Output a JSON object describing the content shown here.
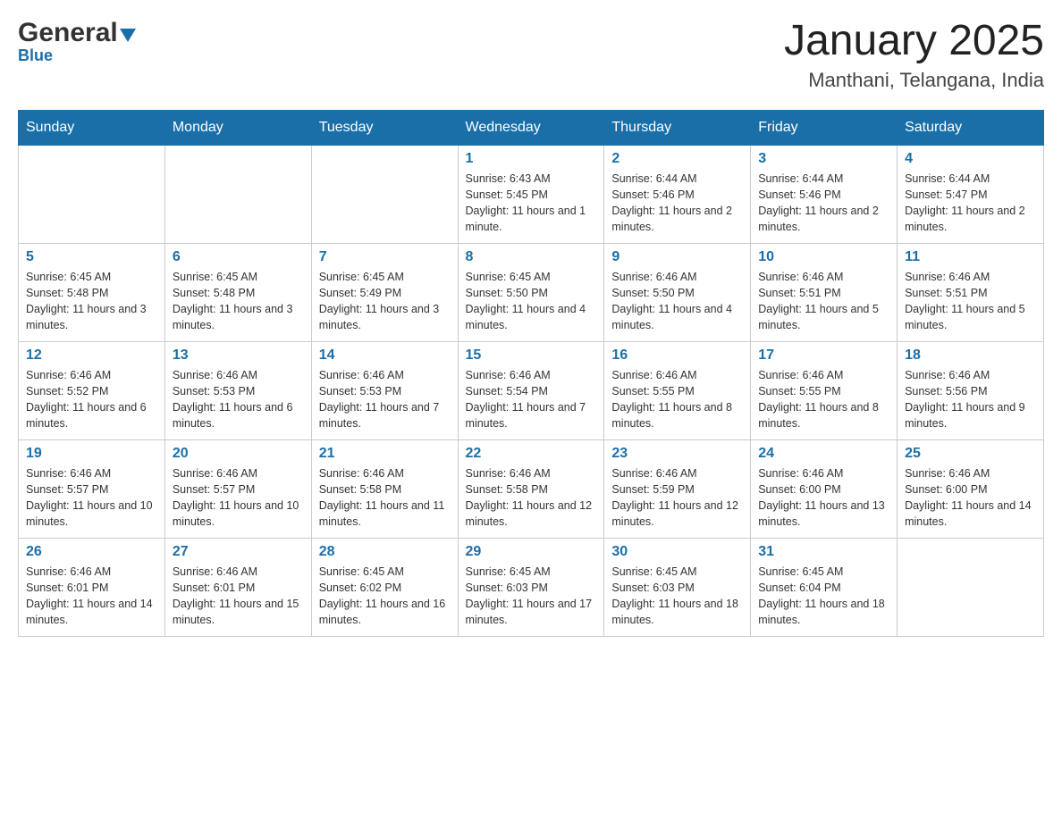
{
  "header": {
    "logo_general": "General",
    "logo_blue": "Blue",
    "title": "January 2025",
    "subtitle": "Manthani, Telangana, India"
  },
  "days_header": [
    "Sunday",
    "Monday",
    "Tuesday",
    "Wednesday",
    "Thursday",
    "Friday",
    "Saturday"
  ],
  "weeks": [
    {
      "cells": [
        {
          "day": null,
          "info": null
        },
        {
          "day": null,
          "info": null
        },
        {
          "day": null,
          "info": null
        },
        {
          "day": "1",
          "info": "Sunrise: 6:43 AM\nSunset: 5:45 PM\nDaylight: 11 hours and 1 minute."
        },
        {
          "day": "2",
          "info": "Sunrise: 6:44 AM\nSunset: 5:46 PM\nDaylight: 11 hours and 2 minutes."
        },
        {
          "day": "3",
          "info": "Sunrise: 6:44 AM\nSunset: 5:46 PM\nDaylight: 11 hours and 2 minutes."
        },
        {
          "day": "4",
          "info": "Sunrise: 6:44 AM\nSunset: 5:47 PM\nDaylight: 11 hours and 2 minutes."
        }
      ]
    },
    {
      "cells": [
        {
          "day": "5",
          "info": "Sunrise: 6:45 AM\nSunset: 5:48 PM\nDaylight: 11 hours and 3 minutes."
        },
        {
          "day": "6",
          "info": "Sunrise: 6:45 AM\nSunset: 5:48 PM\nDaylight: 11 hours and 3 minutes."
        },
        {
          "day": "7",
          "info": "Sunrise: 6:45 AM\nSunset: 5:49 PM\nDaylight: 11 hours and 3 minutes."
        },
        {
          "day": "8",
          "info": "Sunrise: 6:45 AM\nSunset: 5:50 PM\nDaylight: 11 hours and 4 minutes."
        },
        {
          "day": "9",
          "info": "Sunrise: 6:46 AM\nSunset: 5:50 PM\nDaylight: 11 hours and 4 minutes."
        },
        {
          "day": "10",
          "info": "Sunrise: 6:46 AM\nSunset: 5:51 PM\nDaylight: 11 hours and 5 minutes."
        },
        {
          "day": "11",
          "info": "Sunrise: 6:46 AM\nSunset: 5:51 PM\nDaylight: 11 hours and 5 minutes."
        }
      ]
    },
    {
      "cells": [
        {
          "day": "12",
          "info": "Sunrise: 6:46 AM\nSunset: 5:52 PM\nDaylight: 11 hours and 6 minutes."
        },
        {
          "day": "13",
          "info": "Sunrise: 6:46 AM\nSunset: 5:53 PM\nDaylight: 11 hours and 6 minutes."
        },
        {
          "day": "14",
          "info": "Sunrise: 6:46 AM\nSunset: 5:53 PM\nDaylight: 11 hours and 7 minutes."
        },
        {
          "day": "15",
          "info": "Sunrise: 6:46 AM\nSunset: 5:54 PM\nDaylight: 11 hours and 7 minutes."
        },
        {
          "day": "16",
          "info": "Sunrise: 6:46 AM\nSunset: 5:55 PM\nDaylight: 11 hours and 8 minutes."
        },
        {
          "day": "17",
          "info": "Sunrise: 6:46 AM\nSunset: 5:55 PM\nDaylight: 11 hours and 8 minutes."
        },
        {
          "day": "18",
          "info": "Sunrise: 6:46 AM\nSunset: 5:56 PM\nDaylight: 11 hours and 9 minutes."
        }
      ]
    },
    {
      "cells": [
        {
          "day": "19",
          "info": "Sunrise: 6:46 AM\nSunset: 5:57 PM\nDaylight: 11 hours and 10 minutes."
        },
        {
          "day": "20",
          "info": "Sunrise: 6:46 AM\nSunset: 5:57 PM\nDaylight: 11 hours and 10 minutes."
        },
        {
          "day": "21",
          "info": "Sunrise: 6:46 AM\nSunset: 5:58 PM\nDaylight: 11 hours and 11 minutes."
        },
        {
          "day": "22",
          "info": "Sunrise: 6:46 AM\nSunset: 5:58 PM\nDaylight: 11 hours and 12 minutes."
        },
        {
          "day": "23",
          "info": "Sunrise: 6:46 AM\nSunset: 5:59 PM\nDaylight: 11 hours and 12 minutes."
        },
        {
          "day": "24",
          "info": "Sunrise: 6:46 AM\nSunset: 6:00 PM\nDaylight: 11 hours and 13 minutes."
        },
        {
          "day": "25",
          "info": "Sunrise: 6:46 AM\nSunset: 6:00 PM\nDaylight: 11 hours and 14 minutes."
        }
      ]
    },
    {
      "cells": [
        {
          "day": "26",
          "info": "Sunrise: 6:46 AM\nSunset: 6:01 PM\nDaylight: 11 hours and 14 minutes."
        },
        {
          "day": "27",
          "info": "Sunrise: 6:46 AM\nSunset: 6:01 PM\nDaylight: 11 hours and 15 minutes."
        },
        {
          "day": "28",
          "info": "Sunrise: 6:45 AM\nSunset: 6:02 PM\nDaylight: 11 hours and 16 minutes."
        },
        {
          "day": "29",
          "info": "Sunrise: 6:45 AM\nSunset: 6:03 PM\nDaylight: 11 hours and 17 minutes."
        },
        {
          "day": "30",
          "info": "Sunrise: 6:45 AM\nSunset: 6:03 PM\nDaylight: 11 hours and 18 minutes."
        },
        {
          "day": "31",
          "info": "Sunrise: 6:45 AM\nSunset: 6:04 PM\nDaylight: 11 hours and 18 minutes."
        },
        {
          "day": null,
          "info": null
        }
      ]
    }
  ]
}
